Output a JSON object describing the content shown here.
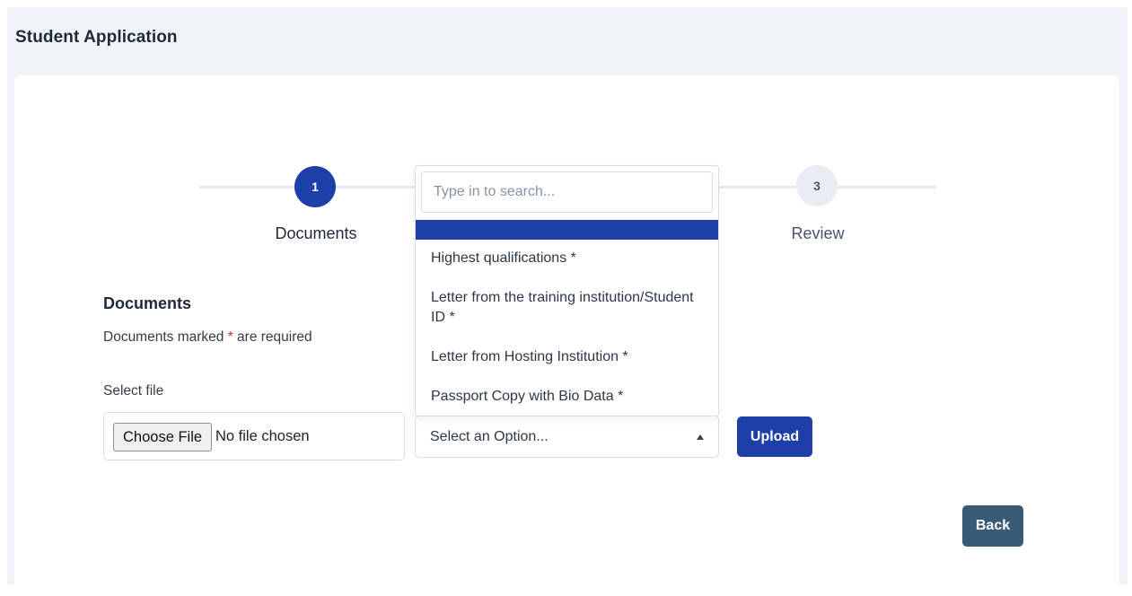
{
  "header": {
    "title": "Student Application"
  },
  "stepper": {
    "steps": [
      {
        "number": "1",
        "label": "Documents",
        "state": "active"
      },
      {
        "number": "3",
        "label": "Review",
        "state": "inactive"
      }
    ]
  },
  "documents": {
    "title": "Documents",
    "required_note_prefix": "Documents marked ",
    "required_marker": "*",
    "required_note_suffix": " are required",
    "select_file_label": "Select file",
    "file_input": {
      "button_label": "Choose File",
      "status_text": "No file chosen"
    },
    "document_type_select": {
      "placeholder": "Select an Option...",
      "search_placeholder": "Type in to search...",
      "options": [
        "Highest qualifications *",
        "Letter from the training institution/Student ID *",
        "Letter from Hosting Institution *",
        "Passport Copy with Bio Data *"
      ]
    },
    "upload_label": "Upload"
  },
  "footer": {
    "back_label": "Back"
  },
  "colors": {
    "primary": "#1e3ea8",
    "back_button": "#3a5b76",
    "required_star": "#dc2626",
    "page_background": "#f0f3f7"
  }
}
